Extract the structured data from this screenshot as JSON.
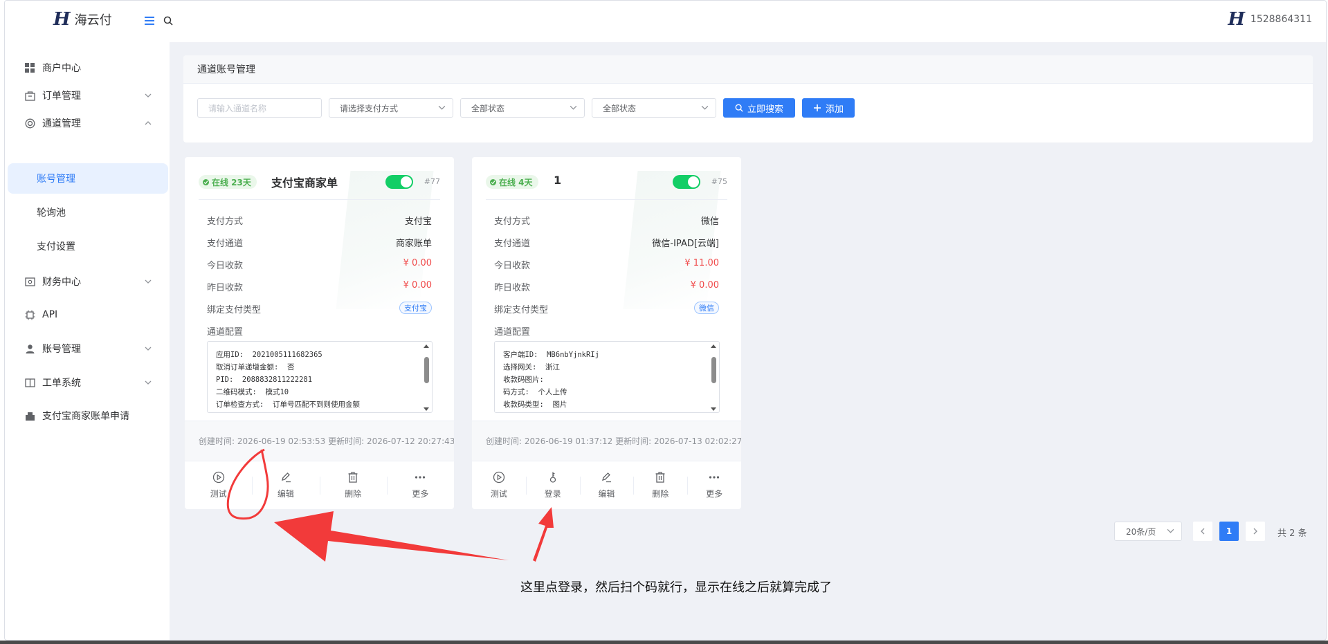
{
  "header": {
    "logo_mark": "H",
    "logo_text": "海云付",
    "user_avatar": "H",
    "user_name": "1528864311"
  },
  "sidebar": {
    "items": [
      {
        "label": "商户中心",
        "icon": "grid-icon"
      },
      {
        "label": "订单管理",
        "icon": "bag-icon"
      },
      {
        "label": "通道管理",
        "icon": "channel-icon"
      },
      {
        "label": "账号管理"
      },
      {
        "label": "轮询池"
      },
      {
        "label": "支付设置"
      },
      {
        "label": "财务中心",
        "icon": "wallet-icon"
      },
      {
        "label": "API",
        "icon": "chip-icon"
      },
      {
        "label": "账号管理",
        "icon": "user-icon"
      },
      {
        "label": "工单系统",
        "icon": "book-icon"
      },
      {
        "label": "支付宝商家账单申请",
        "icon": "bill-icon"
      }
    ]
  },
  "panel": {
    "title": "通道账号管理",
    "filters": {
      "name_placeholder": "请输入通道名称",
      "pay_method": "请选择支付方式",
      "status1": "全部状态",
      "status2": "全部状态"
    },
    "search_label": "立即搜索",
    "add_label": "添加"
  },
  "cards": [
    {
      "badge": "在线 23天",
      "title": "支付宝商家单",
      "number": "#77",
      "rows": {
        "pay_method_label": "支付方式",
        "pay_method": "支付宝",
        "channel_label": "支付通道",
        "channel": "商家账单",
        "today_label": "今日收款",
        "today": "¥ 0.00",
        "yesterday_label": "昨日收款",
        "yesterday": "¥ 0.00",
        "bind_label": "绑定支付类型",
        "bind": "支付宝",
        "config_label": "通道配置"
      },
      "config": "应用ID:  2021005111682365\n取消订单递增金额:  否\nPID:  2088832811222281\n二维码模式:  模式10\n订单检查方式:  订单号匹配不到则使用金额",
      "timeline": "创建时间: 2026-06-19 02:53:53 更新时间: 2026-07-12 20:27:43",
      "actions": [
        "测试",
        "编辑",
        "删除",
        "更多"
      ]
    },
    {
      "badge": "在线 4天",
      "title": "1",
      "number": "#75",
      "rows": {
        "pay_method_label": "支付方式",
        "pay_method": "微信",
        "channel_label": "支付通道",
        "channel": "微信-IPAD[云端]",
        "today_label": "今日收款",
        "today": "¥ 11.00",
        "yesterday_label": "昨日收款",
        "yesterday": "¥ 0.00",
        "bind_label": "绑定支付类型",
        "bind": "微信",
        "config_label": "通道配置"
      },
      "config": "客户端ID:  MB6nbYjnkRIj\n选择网关:  浙江\n收款码图片:\n码方式:  个人上传\n收款码类型:  图片",
      "timeline": "创建时间: 2026-06-19 01:37:12 更新时间: 2026-07-13 02:02:27",
      "actions": [
        "测试",
        "登录",
        "编辑",
        "删除",
        "更多"
      ]
    }
  ],
  "pagination": {
    "page_size": "20条/页",
    "current": "1",
    "total": "共 2 条"
  },
  "annotation": {
    "text": "这里点登录，然后扫个码就行，显示在线之后就算完成了",
    "color": "#f23a3a"
  }
}
